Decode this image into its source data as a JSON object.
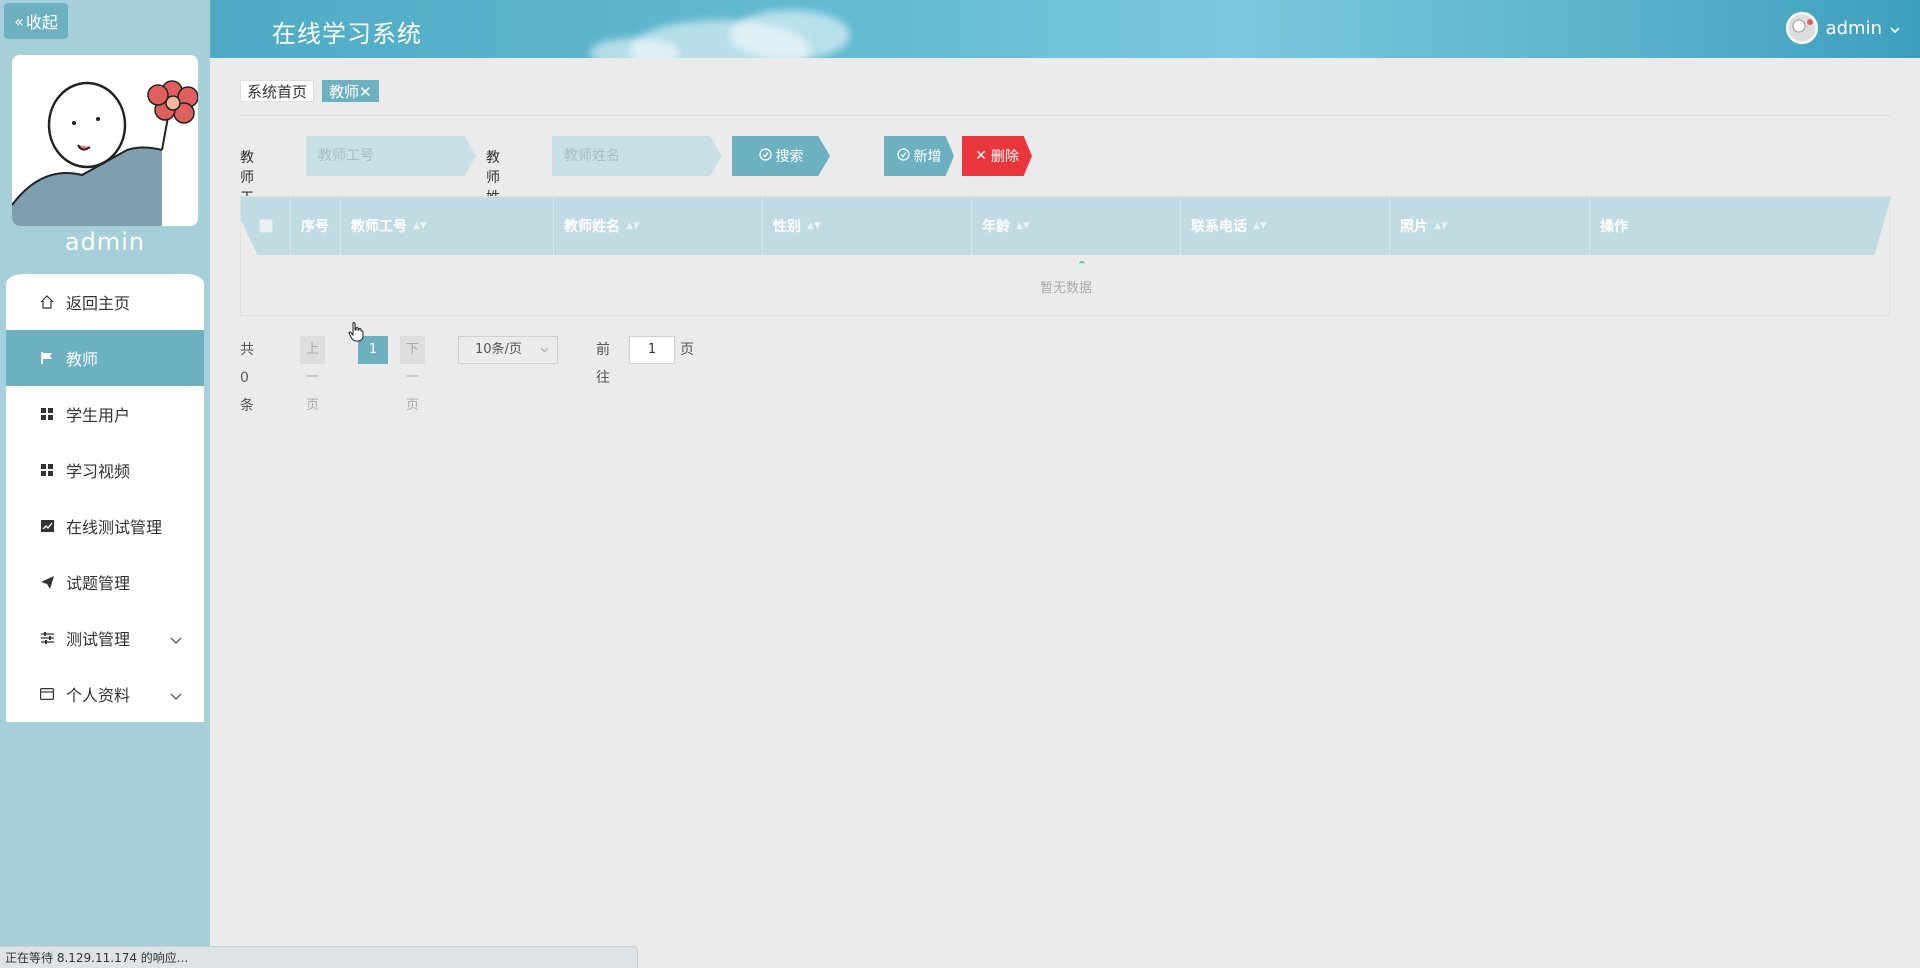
{
  "sidebar": {
    "collapse_label": "收起",
    "username": "admin",
    "items": [
      {
        "label": "返回主页",
        "icon": "home-icon"
      },
      {
        "label": "教师",
        "icon": "flag-icon"
      },
      {
        "label": "学生用户",
        "icon": "grid-icon"
      },
      {
        "label": "学习视频",
        "icon": "grid-icon"
      },
      {
        "label": "在线测试管理",
        "icon": "chart-icon"
      },
      {
        "label": "试题管理",
        "icon": "send-icon"
      },
      {
        "label": "测试管理",
        "icon": "sliders-icon"
      },
      {
        "label": "个人资料",
        "icon": "card-icon"
      }
    ]
  },
  "header": {
    "title": "在线学习系统",
    "user": "admin"
  },
  "tabs": [
    {
      "label": "系统首页"
    },
    {
      "label": "教师"
    }
  ],
  "search": {
    "label_id": "教师工号",
    "placeholder_id": "教师工号",
    "label_name": "教师姓名",
    "placeholder_name": "教师姓名",
    "search_btn": "搜索",
    "add_btn": "新增",
    "delete_btn": "删除"
  },
  "table": {
    "columns": [
      "序号",
      "教师工号",
      "教师姓名",
      "性别",
      "年龄",
      "联系电话",
      "照片",
      "操作"
    ],
    "empty_text": "暂无数据"
  },
  "pager": {
    "total": "共 0 条",
    "prev": "上一页",
    "current": "1",
    "next": "下一页",
    "page_size": "10条/页",
    "goto_label": "前往",
    "goto_value": "1",
    "page_unit": "页"
  },
  "status": "正在等待 8.129.11.174 的响应...",
  "colors": {
    "accent": "#6db1c1",
    "danger": "#e8363c",
    "sidebar_bg": "#a6cfd9"
  }
}
